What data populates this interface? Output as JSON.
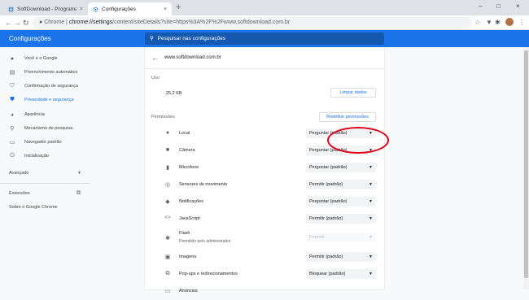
{
  "browser": {
    "tabs": [
      {
        "title": "SoftDownload - Programas e jogo",
        "close": "×"
      },
      {
        "title": "Configurações",
        "close": "×"
      }
    ],
    "new_tab": "+",
    "controls": {
      "minimize": "–",
      "maximize": "□",
      "close": "×"
    },
    "address": {
      "origin": "Chrome",
      "separator": "|",
      "host": "chrome://settings",
      "path": "/content/siteDetails?site=https%3A%2F%2Fwww.softdownload.com.br"
    }
  },
  "header": {
    "title": "Configurações",
    "search_placeholder": "Pesquisar nas configurações"
  },
  "sidebar": {
    "items": [
      {
        "label": "Você e o Google"
      },
      {
        "label": "Preenchimento automático"
      },
      {
        "label": "Confirmação de segurança"
      },
      {
        "label": "Privacidade e segurança"
      },
      {
        "label": "Aparência"
      },
      {
        "label": "Mecanismo de pesquisa"
      },
      {
        "label": "Navegador padrão"
      },
      {
        "label": "Inicialização"
      }
    ],
    "advanced": "Avançado",
    "extensions": "Extensões",
    "about": "Sobre o Google Chrome"
  },
  "site": {
    "name": "www.softdownload.com.br",
    "usage_heading": "Uso",
    "usage_value": "25,2 KB",
    "clear_button": "Limpar dados",
    "permissions_heading": "Permissões",
    "reset_button": "Redefinir permissões",
    "permissions": [
      {
        "label": "Local",
        "value": "Perguntar (padrão)",
        "icon": "location-icon"
      },
      {
        "label": "Câmera",
        "value": "Perguntar (padrão)",
        "icon": "camera-icon"
      },
      {
        "label": "Microfone",
        "value": "Perguntar (padrão)",
        "icon": "microphone-icon"
      },
      {
        "label": "Sensores de movimento",
        "value": "Permitir (padrão)",
        "icon": "sensors-icon"
      },
      {
        "label": "Notificações",
        "value": "Perguntar (padrão)",
        "icon": "bell-icon"
      },
      {
        "label": "JavaScript",
        "value": "Permitir (padrão)",
        "icon": "code-icon"
      },
      {
        "label": "Flash",
        "sub": "Permitido pelo administrador",
        "value": "Permitir",
        "icon": "puzzle-icon"
      },
      {
        "label": "Imagens",
        "value": "Permitir (padrão)",
        "icon": "image-icon"
      },
      {
        "label": "Pop-ups e redirecionamentos",
        "value": "Bloquear (padrão)",
        "icon": "popup-icon"
      },
      {
        "label": "Anúncios",
        "value": "",
        "icon": "ads-icon"
      }
    ]
  },
  "colors": {
    "accent": "#1a73e8",
    "highlight_circle": "#e0001a"
  }
}
